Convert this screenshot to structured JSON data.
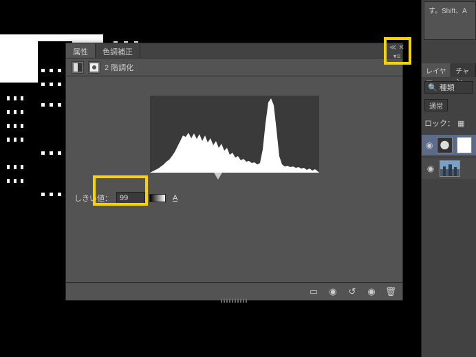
{
  "tooltip_fragment": "す。Shift、A",
  "panel": {
    "tabs": {
      "properties": "属性",
      "color_correction": "色調補正"
    },
    "title": "2 階調化",
    "threshold_label": "しきい値：",
    "threshold_value": "99",
    "auto_label": "A"
  },
  "right_panel": {
    "tab_layers": "レイヤー",
    "tab_channels": "チャン",
    "search_label": "種類",
    "blend_mode": "通常",
    "lock_label": "ロック："
  }
}
